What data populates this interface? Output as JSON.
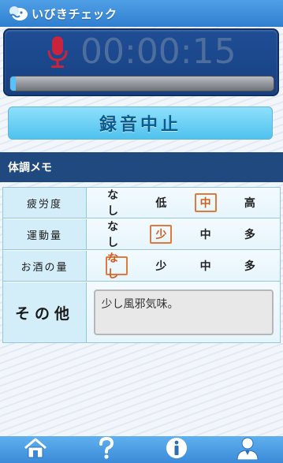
{
  "header": {
    "title": "いびきチェック"
  },
  "recorder": {
    "timer": "00:00:15",
    "progress": 0.02
  },
  "stop_button": {
    "label": "録音中止"
  },
  "memo": {
    "title": "体調メモ",
    "rows": [
      {
        "label": "疲労度",
        "options": [
          "なし",
          "低",
          "中",
          "高"
        ],
        "selected": 2
      },
      {
        "label": "運動量",
        "options": [
          "なし",
          "少",
          "中",
          "多"
        ],
        "selected": 1
      },
      {
        "label": "お酒の量",
        "options": [
          "なし",
          "少",
          "中",
          "多"
        ],
        "selected": 0
      }
    ],
    "other": {
      "label": "その他",
      "value": "少し風邪気味。"
    }
  },
  "nav": {
    "icons": [
      "home-icon",
      "help-icon",
      "info-icon",
      "profile-icon"
    ]
  },
  "colors": {
    "header": "#3a8ad8",
    "recorder_bg": "#1b4789",
    "stop_button": "#6fd2f6",
    "selected_border": "#e07a3c",
    "memo_header": "#1f497f"
  }
}
